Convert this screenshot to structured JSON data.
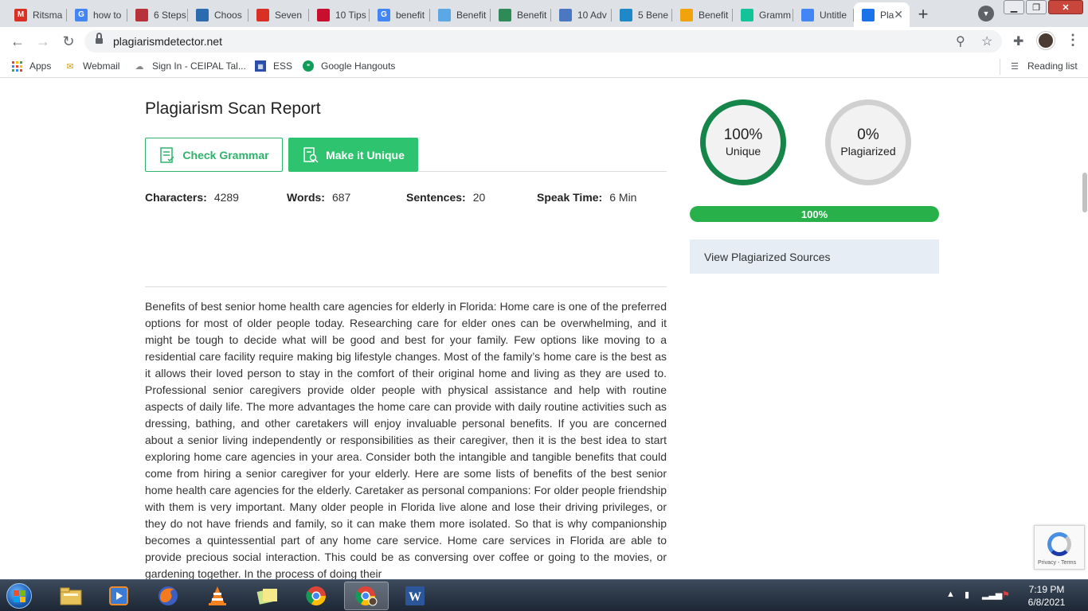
{
  "browser": {
    "tabs": [
      {
        "label": "Ritsma",
        "icon": "gmail-icon",
        "color": "#d93025"
      },
      {
        "label": "how to",
        "icon": "google-icon",
        "color": "#4285f4"
      },
      {
        "label": "6 Steps",
        "icon": "site-icon",
        "color": "#b8323c"
      },
      {
        "label": "Choos",
        "icon": "site-icon",
        "color": "#2b6cb0"
      },
      {
        "label": "Seven",
        "icon": "site-icon",
        "color": "#d93025"
      },
      {
        "label": "10 Tips",
        "icon": "site-icon",
        "color": "#c8102e"
      },
      {
        "label": "benefit",
        "icon": "google-icon",
        "color": "#4285f4"
      },
      {
        "label": "Benefit",
        "icon": "site-icon",
        "color": "#5aa9e6"
      },
      {
        "label": "Benefit",
        "icon": "site-icon",
        "color": "#2e8b57"
      },
      {
        "label": "10 Adv",
        "icon": "site-icon",
        "color": "#4a78c2"
      },
      {
        "label": "5 Bene",
        "icon": "site-icon",
        "color": "#1e88c8"
      },
      {
        "label": "Benefit",
        "icon": "site-icon",
        "color": "#f0a30a"
      },
      {
        "label": "Gramm",
        "icon": "grammarly-icon",
        "color": "#15c39a"
      },
      {
        "label": "Untitle",
        "icon": "docs-icon",
        "color": "#4285f4"
      },
      {
        "label": "Pla",
        "icon": "plagiarism-icon",
        "color": "#1a73e8",
        "active": true
      }
    ],
    "url": "plagiarismdetector.net",
    "bookmarks": [
      {
        "label": "Apps",
        "icon": "apps-grid-icon"
      },
      {
        "label": "Webmail",
        "icon": "mail-icon"
      },
      {
        "label": "Sign In - CEIPAL Tal...",
        "icon": "ceipal-icon"
      },
      {
        "label": "ESS",
        "icon": "ess-icon"
      },
      {
        "label": "Google Hangouts",
        "icon": "hangouts-icon"
      }
    ],
    "reading_list": "Reading list"
  },
  "report": {
    "title": "Plagiarism Scan Report",
    "check_grammar": "Check Grammar",
    "make_unique": "Make it Unique",
    "stats": {
      "characters_label": "Characters:",
      "characters": "4289",
      "words_label": "Words:",
      "words": "687",
      "sentences_label": "Sentences:",
      "sentences": "20",
      "speak_time_label": "Speak Time:",
      "speak_time": "6 Min"
    },
    "body": "Benefits of best senior home health care agencies for elderly in Florida: Home care is one of the preferred options for most of older people today. Researching care for elder ones can be overwhelming, and it might be tough to decide what will be good and best for your family. Few options like moving to a residential care facility require making big lifestyle changes. Most of the family’s home care is the best as it allows their loved person to stay in the comfort of their original home and living as they are used to. Professional senior caregivers provide older people with physical assistance and help with routine aspects of daily life. The more advantages the home care can provide with daily routine activities such as dressing, bathing, and other caretakers will enjoy invaluable personal benefits. If you are concerned about a senior living independently or responsibilities as their caregiver, then it is the best idea to start exploring home care agencies in your area. Consider both the intangible and tangible benefits that could come from hiring a senior caregiver for your elderly. Here are some lists of benefits of the best senior home health care agencies for the elderly. Caretaker as personal companions: For older people friendship with them is very important. Many older people in Florida live alone and lose their driving privileges, or they do not have friends and family, so it can make them more isolated. So that is why companionship becomes a quintessential part of any home care service. Home care services in Florida are able to provide precious social interaction. This could be as conversing over coffee or going to the movies, or gardening together. In the process of doing their"
  },
  "results": {
    "unique_pct": "100%",
    "unique_label": "Unique",
    "plagiarized_pct": "0%",
    "plagiarized_label": "Plagiarized",
    "progress_value": 1.0,
    "progress_label": "100%",
    "view_sources": "View Plagiarized Sources"
  },
  "recaptcha": {
    "text": "Privacy - Terms"
  },
  "taskbar": {
    "apps": [
      "explorer-icon",
      "media-player-icon",
      "firefox-icon",
      "vlc-icon",
      "sticky-notes-icon",
      "chrome-icon",
      "chrome-profile-icon",
      "word-icon"
    ],
    "time": "7:19 PM",
    "date": "6/8/2021"
  },
  "colors": {
    "accent_green": "#2ec36e",
    "unique_ring": "#16854a",
    "progress": "#28b04a",
    "sources_bg": "#e6edf5"
  }
}
